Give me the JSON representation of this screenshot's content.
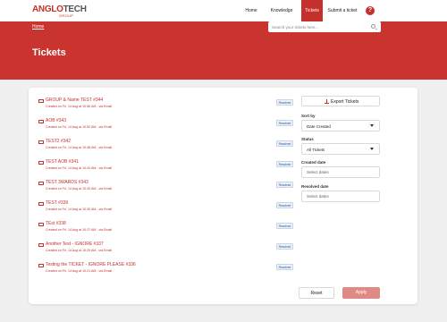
{
  "brand": {
    "logo_part1": "ANGLO",
    "logo_part2": "TECH",
    "logo_sub": "GROUP",
    "accent_color": "#c4302b"
  },
  "nav": {
    "home": "Home",
    "knowledge_base": "Knowledge base",
    "tickets": "Tickets",
    "submit": "Submit a ticket",
    "help_icon": "question-icon",
    "help_label": "?"
  },
  "banner": {
    "breadcrumb": "Home",
    "search_placeholder": "Search your tickets here...",
    "search_icon": "search-icon",
    "title": "Tickets"
  },
  "tickets": [
    {
      "title": "GROUP & Name TEST #344",
      "subtitle": "Created on Fri, 14 Aug at 10:56 AM - via Email",
      "status": "Resolved"
    },
    {
      "title": "AOB #343",
      "subtitle": "Created on Fri, 14 Aug at 10:52 AM - via Email",
      "status": "Resolved"
    },
    {
      "title": "TEST2 #342",
      "subtitle": "Created on Fri, 14 Aug at 10:48 AM - via Email",
      "status": "Resolved"
    },
    {
      "title": "TEST AOB #341",
      "subtitle": "Created on Fri, 14 Aug at 10:43 AM - via Email",
      "status": "Resolved"
    },
    {
      "title": "TEST 3WARDS #343",
      "subtitle": "Created on Fri, 14 Aug at 10:30 AM - via Email",
      "status": "Resolved"
    },
    {
      "title": "TEST #339",
      "subtitle": "Created on Fri, 14 Aug at 10:30 AM - via Email",
      "status": "Resolved"
    },
    {
      "title": "TEst #338",
      "subtitle": "Created on Fri, 14 Aug at 10:27 AM - via Email",
      "status": "Resolved"
    },
    {
      "title": "Another Test - IGNORE #337",
      "subtitle": "Created on Fri, 14 Aug at 10:25 AM - via Email",
      "status": "Resolved"
    },
    {
      "title": "Testing the TICKET - IGNORE PLEASE #336",
      "subtitle": "Created on Fri, 14 Aug at 10:21 AM - via Email",
      "status": "Resolved"
    }
  ],
  "filters": {
    "export_label": "Export Tickets",
    "sort_label": "Sort by",
    "sort_value": "Date Created",
    "status_label": "Status",
    "status_value": "All Tickets",
    "created_label": "Created date",
    "created_placeholder": "Select dates",
    "resolved_label": "Resolved date",
    "resolved_placeholder": "Select dates",
    "reset_label": "Reset",
    "apply_label": "Apply"
  }
}
